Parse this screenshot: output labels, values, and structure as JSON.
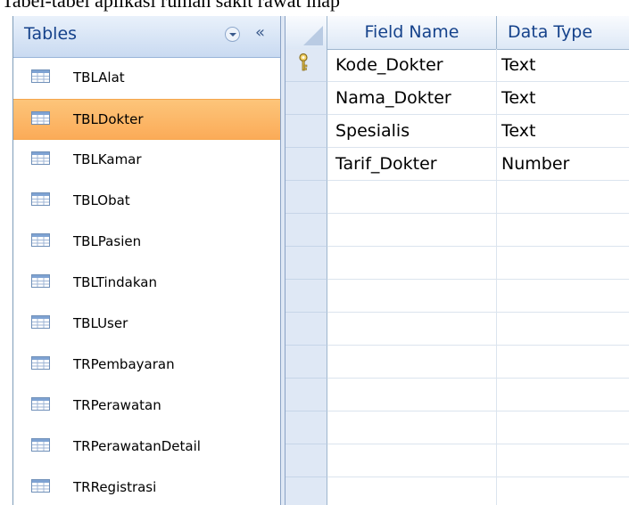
{
  "top_text": "Tabel-tabel aplikasi rumah sakit rawat inap",
  "nav": {
    "title": "Tables",
    "collapse_glyph": "«",
    "items": [
      {
        "label": "TBLAlat",
        "selected": false
      },
      {
        "label": "TBLDokter",
        "selected": true
      },
      {
        "label": "TBLKamar",
        "selected": false
      },
      {
        "label": "TBLObat",
        "selected": false
      },
      {
        "label": "TBLPasien",
        "selected": false
      },
      {
        "label": "TBLTindakan",
        "selected": false
      },
      {
        "label": "TBLUser",
        "selected": false
      },
      {
        "label": "TRPembayaran",
        "selected": false
      },
      {
        "label": "TRPerawatan",
        "selected": false
      },
      {
        "label": "TRPerawatanDetail",
        "selected": false
      },
      {
        "label": "TRRegistrasi",
        "selected": false
      }
    ]
  },
  "grid": {
    "headers": {
      "field_name": "Field Name",
      "data_type": "Data Type"
    },
    "rows": [
      {
        "field": "Kode_Dokter",
        "type": "Text",
        "primary_key": true
      },
      {
        "field": "Nama_Dokter",
        "type": "Text",
        "primary_key": false
      },
      {
        "field": "Spesialis",
        "type": "Text",
        "primary_key": false
      },
      {
        "field": "Tarif_Dokter",
        "type": "Number",
        "primary_key": false
      },
      {
        "field": "",
        "type": "",
        "primary_key": false
      },
      {
        "field": "",
        "type": "",
        "primary_key": false
      },
      {
        "field": "",
        "type": "",
        "primary_key": false
      },
      {
        "field": "",
        "type": "",
        "primary_key": false
      },
      {
        "field": "",
        "type": "",
        "primary_key": false
      },
      {
        "field": "",
        "type": "",
        "primary_key": false
      },
      {
        "field": "",
        "type": "",
        "primary_key": false
      },
      {
        "field": "",
        "type": "",
        "primary_key": false
      },
      {
        "field": "",
        "type": "",
        "primary_key": false
      },
      {
        "field": "",
        "type": "",
        "primary_key": false
      }
    ]
  },
  "colors": {
    "selected_item": "#fbab58",
    "header_text": "#15428b"
  }
}
